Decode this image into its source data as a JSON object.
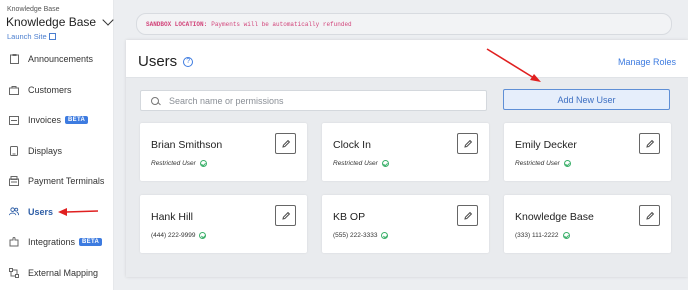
{
  "sidebar": {
    "org_label": "Knowledge Base",
    "org_name": "Knowledge Base",
    "launch_site": "Launch Site",
    "items": [
      {
        "label": "Announcements",
        "icon": "clipboard-icon",
        "active": false,
        "beta": ""
      },
      {
        "label": "Customers",
        "icon": "bag-icon",
        "active": false,
        "beta": ""
      },
      {
        "label": "Invoices",
        "icon": "invoice-icon",
        "active": false,
        "beta": "BETA"
      },
      {
        "label": "Displays",
        "icon": "tablet-icon",
        "active": false,
        "beta": ""
      },
      {
        "label": "Payment Terminals",
        "icon": "terminal-icon",
        "active": false,
        "beta": ""
      },
      {
        "label": "Users",
        "icon": "users-icon",
        "active": true,
        "beta": ""
      },
      {
        "label": "Integrations",
        "icon": "puzzle-icon",
        "active": false,
        "beta": "BETA"
      },
      {
        "label": "External Mapping",
        "icon": "mapping-icon",
        "active": false,
        "beta": ""
      }
    ]
  },
  "sandbox": {
    "label": "SANDBOX LOCATION:",
    "message": "Payments will be automatically refunded"
  },
  "users_panel": {
    "title": "Users",
    "manage_roles": "Manage Roles",
    "search_placeholder": "Search name or permissions",
    "add_button": "Add New User",
    "cards": [
      {
        "name": "Brian Smithson",
        "sub": "Restricted User",
        "italic": true
      },
      {
        "name": "Clock In",
        "sub": "Restricted User",
        "italic": true
      },
      {
        "name": "Emily Decker",
        "sub": "Restricted User",
        "italic": true
      },
      {
        "name": "Hank Hill",
        "sub": "(444) 222-9999",
        "italic": false
      },
      {
        "name": "KB OP",
        "sub": "(555) 222-3333",
        "italic": false
      },
      {
        "name": "Knowledge Base",
        "sub": "(333) 111-2222",
        "italic": false
      }
    ]
  },
  "colors": {
    "accent": "#3d7be0",
    "annotation_arrow": "#e02020",
    "verified": "#3bb06a",
    "sandbox_text": "#d2447a"
  }
}
